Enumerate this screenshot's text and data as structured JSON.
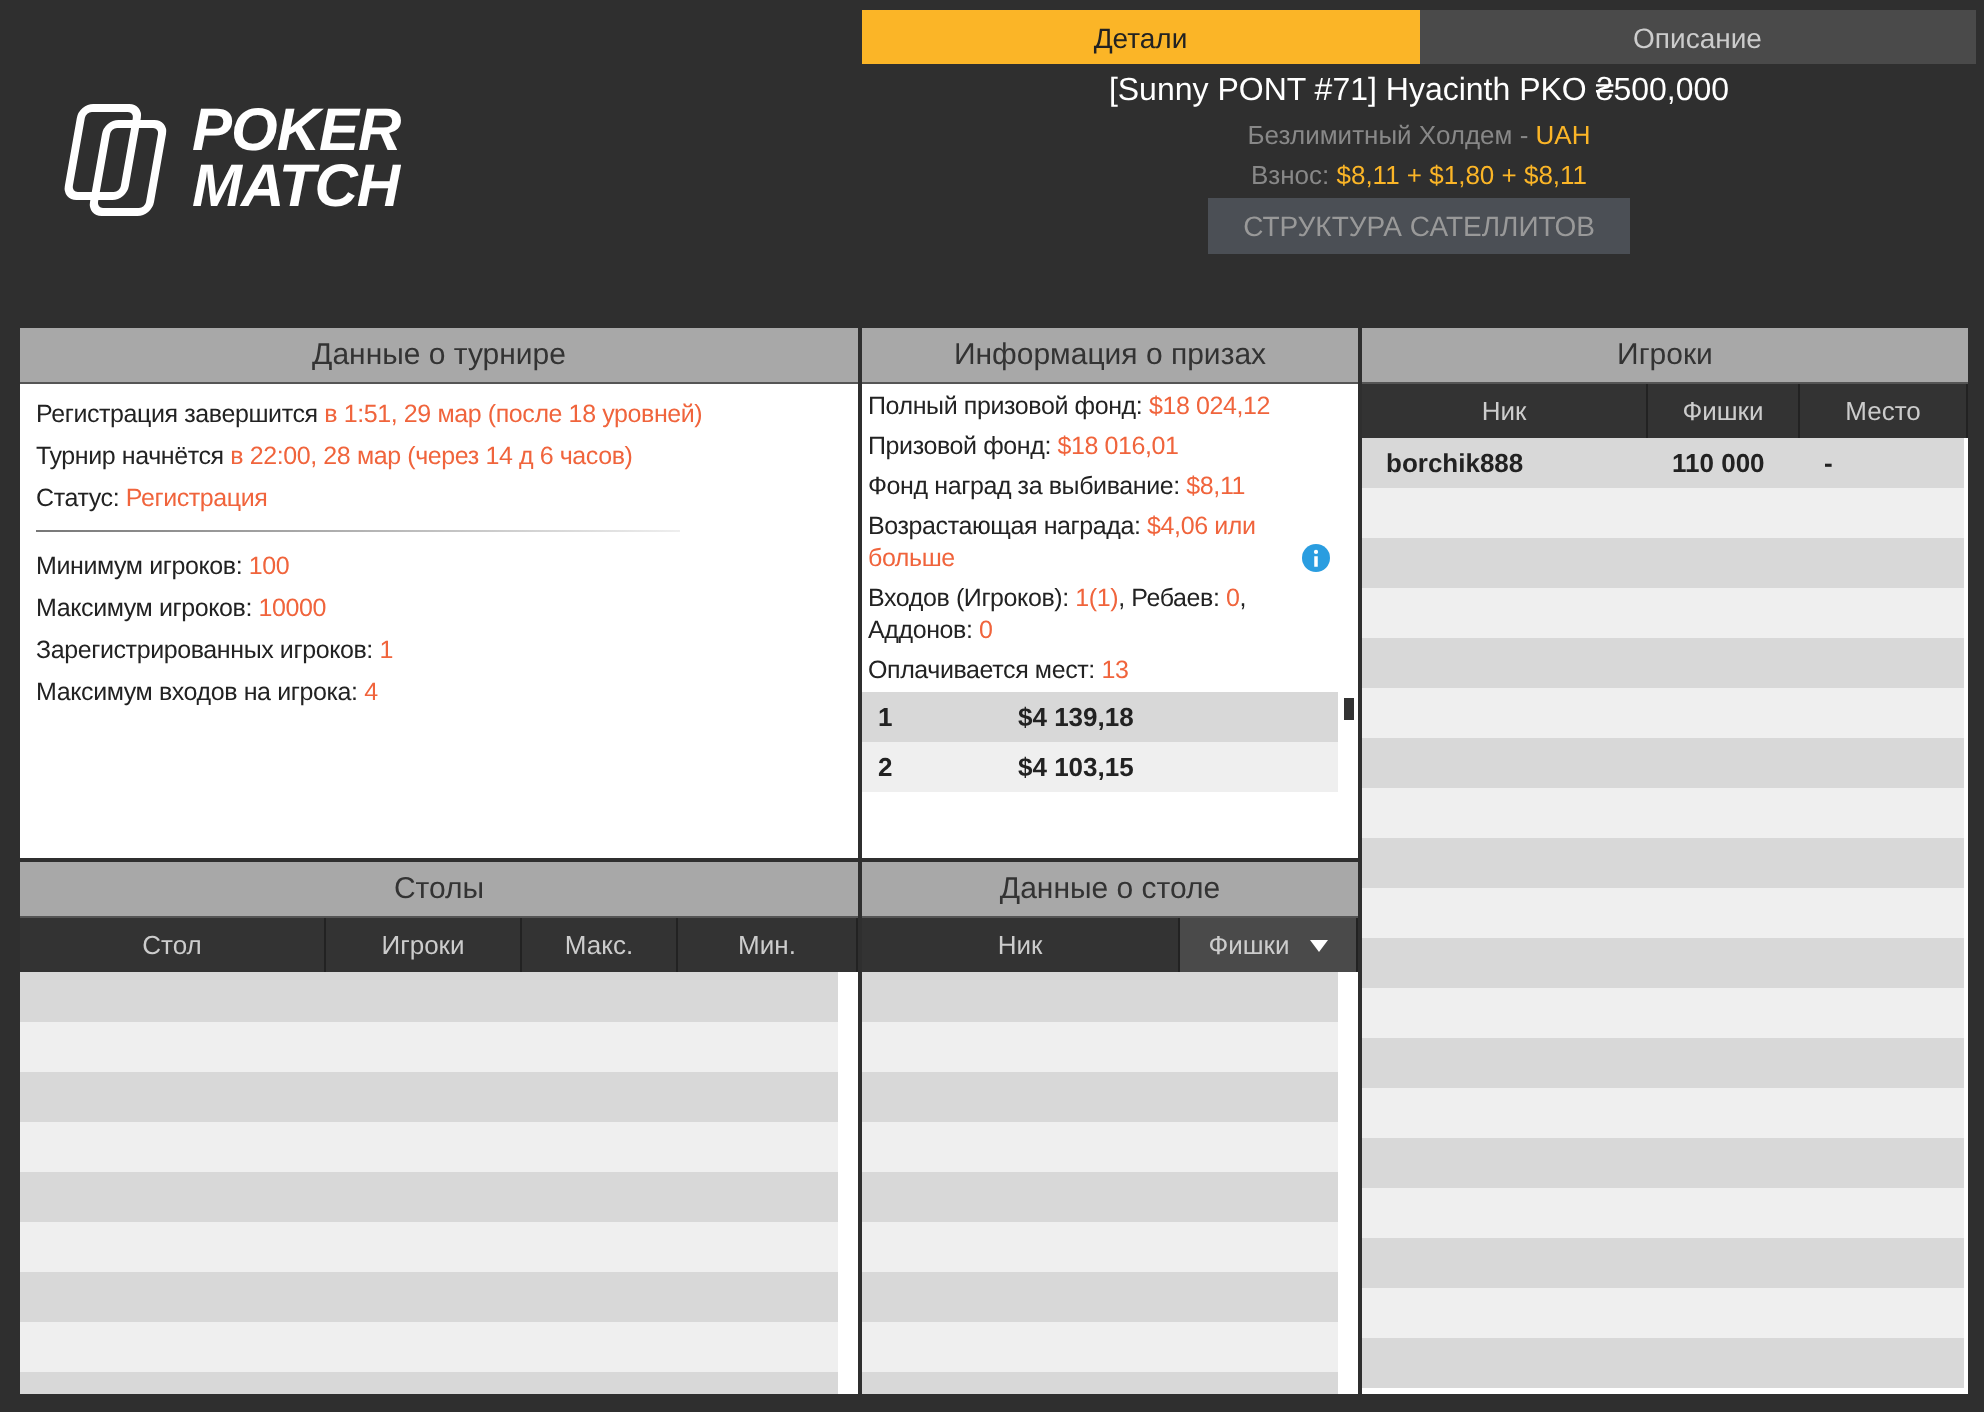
{
  "logo": {
    "lines": [
      "POKER",
      "MATCH"
    ]
  },
  "tabs": [
    {
      "label": "Детали",
      "selected": true
    },
    {
      "label": "Описание",
      "selected": false
    }
  ],
  "tournament": {
    "title": "[Sunny PONT #71] Hyacinth PKO ₴500,000",
    "game": "Безлимитный Холдем - ",
    "currency": "UAH",
    "fee_label": "Взнос: ",
    "fee": "$8,11 + $1,80 + $8,11",
    "button": "СТРУКТУРА САТЕЛЛИТОВ"
  },
  "tournament_info": {
    "title": "Данные о турнире",
    "groups": [
      [
        [
          {
            "label": "Регистрация завершится ",
            "value": "в 1:51, 29 мар (после 18 уровней)"
          }
        ],
        [
          {
            "label": "Турнир начнётся ",
            "value": "в 22:00, 28 мар (через 14 д 6 часов)"
          }
        ],
        [
          {
            "label": "Статус: ",
            "value": "Регистрация"
          }
        ]
      ],
      [
        [
          {
            "label": "Минимум игроков: ",
            "value": "100"
          }
        ],
        [
          {
            "label": "Максимум игроков: ",
            "value": "10000"
          }
        ],
        [
          {
            "label": "Зарегистрированных игроков: ",
            "value": "1"
          }
        ],
        [
          {
            "label": "Максимум входов на игрока: ",
            "value": "4"
          }
        ]
      ]
    ]
  },
  "prize_info": {
    "title": "Информация о призах",
    "lines": [
      {
        "parts": [
          {
            "label": "Полный призовой фонд: ",
            "value": "$18 024,12"
          }
        ],
        "info": false
      },
      {
        "parts": [
          {
            "label": "Призовой фонд: ",
            "value": "$18 016,01"
          }
        ],
        "info": false
      },
      {
        "parts": [
          {
            "label": "Фонд наград за выбивание: ",
            "value": "$8,11"
          }
        ],
        "info": false
      },
      {
        "parts": [
          {
            "label": "Возрастающая награда: ",
            "value": "$4,06 или больше"
          }
        ],
        "info": true
      },
      {
        "parts": [
          {
            "label": "Входов (Игроков): ",
            "value": "1(1)"
          },
          {
            "label": ", Ребаев: ",
            "value": "0"
          },
          {
            "label": ", Аддонов: ",
            "value": "0"
          }
        ],
        "info": false
      },
      {
        "parts": [
          {
            "label": "Оплачивается мест: ",
            "value": "13"
          }
        ],
        "info": false
      }
    ],
    "payouts": [
      {
        "place": "1",
        "amount": "$4 139,18"
      },
      {
        "place": "2",
        "amount": "$4 103,15"
      }
    ]
  },
  "players": {
    "title": "Игроки",
    "columns": [
      {
        "label": "Ник",
        "sorted": false
      },
      {
        "label": "Фишки",
        "sorted": false
      },
      {
        "label": "Место",
        "sorted": false
      }
    ],
    "rows": [
      [
        "borchik888",
        "110 000",
        "-"
      ]
    ]
  },
  "tables": {
    "title": "Столы",
    "columns": [
      {
        "label": "Стол",
        "sorted": false
      },
      {
        "label": "Игроки",
        "sorted": false
      },
      {
        "label": "Макс.",
        "sorted": false
      },
      {
        "label": "Мин.",
        "sorted": false
      }
    ]
  },
  "table_data": {
    "title": "Данные о столе",
    "columns": [
      {
        "label": "Ник",
        "sorted": false
      },
      {
        "label": "Фишки",
        "sorted": true
      }
    ]
  }
}
